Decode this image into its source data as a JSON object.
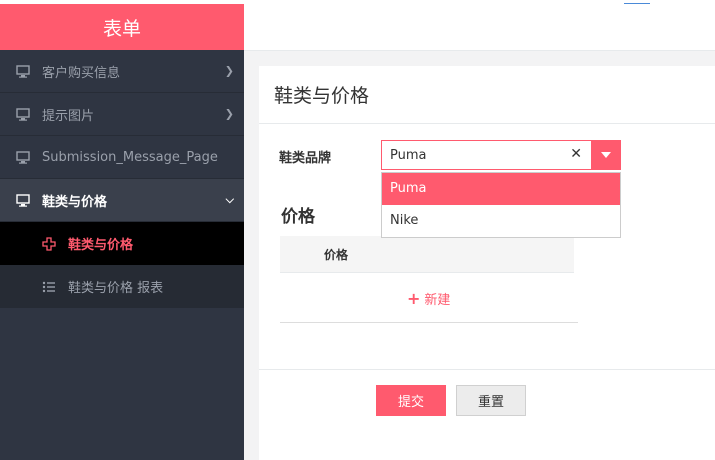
{
  "sidebar": {
    "brand": "表单",
    "items": [
      {
        "label": "客户购买信息",
        "icon": "monitor-icon"
      },
      {
        "label": "提示图片",
        "icon": "monitor-icon"
      },
      {
        "label": "Submission_Message_Page",
        "icon": "monitor-icon"
      },
      {
        "label": "鞋类与价格",
        "icon": "monitor-icon"
      }
    ],
    "subitems": [
      {
        "label": "鞋类与价格",
        "icon": "plus-icon"
      },
      {
        "label": "鞋类与价格 报表",
        "icon": "list-icon"
      }
    ]
  },
  "main": {
    "title": "鞋类与价格",
    "brand_field": {
      "label": "鞋类品牌",
      "value": "Puma",
      "options": [
        "Puma",
        "Nike"
      ]
    },
    "price_section": {
      "title": "价格",
      "column_header": "价格",
      "add_label": "新建"
    },
    "buttons": {
      "submit": "提交",
      "reset": "重置"
    }
  },
  "colors": {
    "accent": "#ff5a6e",
    "sidebar_bg": "#2f3542"
  }
}
